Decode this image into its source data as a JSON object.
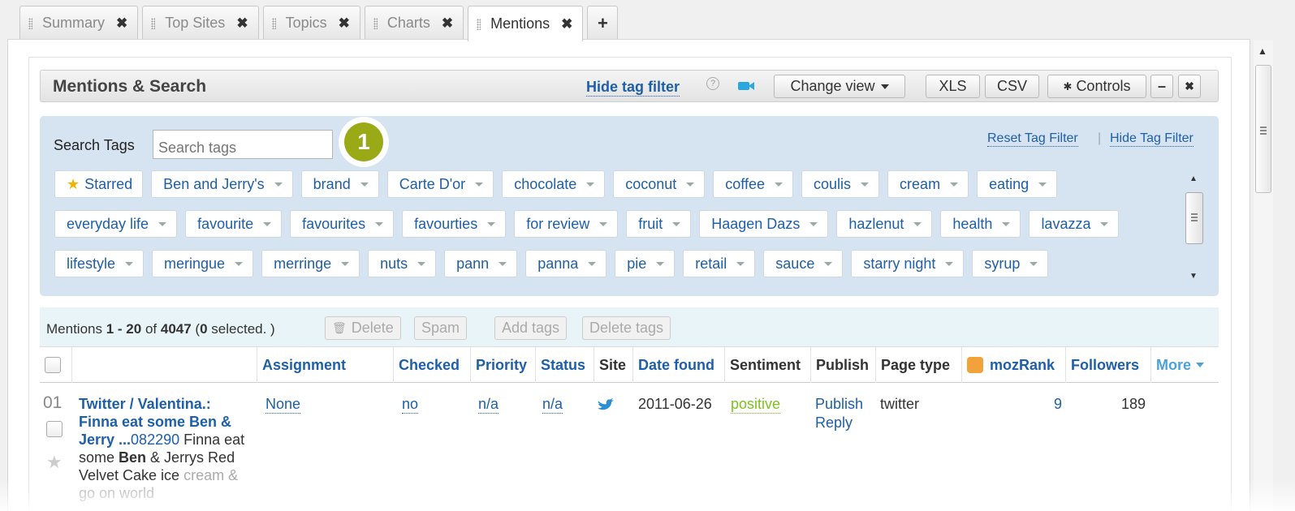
{
  "tabs": [
    {
      "label": "Summary",
      "active": false
    },
    {
      "label": "Top Sites",
      "active": false
    },
    {
      "label": "Topics",
      "active": false
    },
    {
      "label": "Charts",
      "active": false
    },
    {
      "label": "Mentions",
      "active": true
    }
  ],
  "tab_close_glyph": "✖",
  "tab_add_glyph": "+",
  "header": {
    "title": "Mentions & Search",
    "hide_tag_filter": "Hide tag filter",
    "help_glyph": "?",
    "change_view": "Change view",
    "xls": "XLS",
    "csv": "CSV",
    "controls": "Controls",
    "minimize_glyph": "–",
    "close_glyph": "✖"
  },
  "tag_filter": {
    "search_label": "Search Tags",
    "search_placeholder": "Search tags",
    "step_badge": "1",
    "reset": "Reset Tag Filter",
    "separator": "|",
    "hide": "Hide Tag Filter",
    "rows": [
      [
        "Starred",
        "Ben and Jerry's",
        "brand",
        "Carte D'or",
        "chocolate",
        "coconut",
        "coffee",
        "coulis",
        "cream",
        "eating"
      ],
      [
        "everyday life",
        "favourite",
        "favourites",
        "favourties",
        "for review",
        "fruit",
        "Haagen Dazs",
        "hazlenut",
        "health",
        "lavazza"
      ],
      [
        "lifestyle",
        "meringue",
        "merringe",
        "nuts",
        "pann",
        "panna",
        "pie",
        "retail",
        "sauce",
        "starry night",
        "syrup"
      ]
    ]
  },
  "mentions_bar": {
    "prefix": "Mentions",
    "range": "1 - 20",
    "of": "of",
    "total": "4047",
    "selected_open": "(",
    "selected_count": "0",
    "selected_text": "selected. )",
    "delete": "Delete",
    "spam": "Spam",
    "add_tags": "Add tags",
    "delete_tags": "Delete tags"
  },
  "columns": [
    "Assignment",
    "Checked",
    "Priority",
    "Status",
    "Site",
    "Date found",
    "Sentiment",
    "Publish",
    "Page type",
    "mozRank",
    "Followers",
    "More"
  ],
  "rows": [
    {
      "num": "01",
      "title": "Twitter / Valentina.: Finna eat some Ben & Jerry ...",
      "link_id": "082290",
      "snippet_pre": " Finna eat some ",
      "snippet_bold": "Ben",
      "snippet_post": " & Jerrys Red Velvet Cake ice",
      "snippet_fade": "cream & go on world",
      "assignment": "None",
      "checked": "no",
      "priority": "n/a",
      "status": "n/a",
      "site_icon": "twitter-bird-icon",
      "date_found": "2011-06-26",
      "sentiment": "positive",
      "publish": "Publish",
      "reply": "Reply",
      "page_type": "twitter",
      "mozrank": "9",
      "followers": "189"
    }
  ],
  "colors": {
    "link": "#1e5fa8",
    "tag_area": "#d6e3f0",
    "mentions_bar": "#e8f4f7",
    "badge": "#9aaa17",
    "positive": "#7fbf1f",
    "twitter": "#2aa6e0",
    "star": "#f0b400"
  }
}
